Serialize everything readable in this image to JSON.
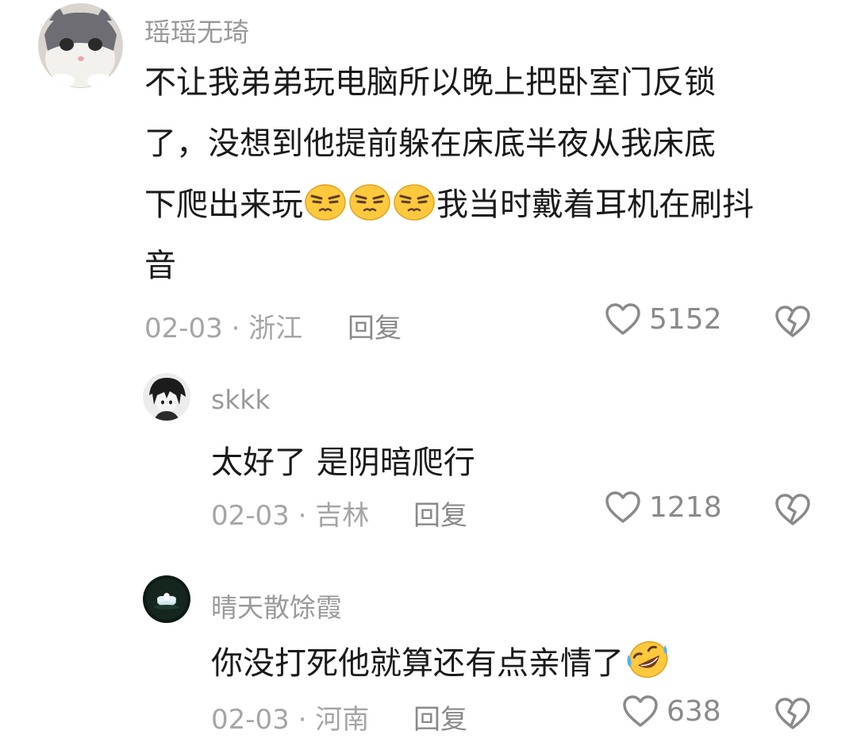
{
  "comments": [
    {
      "username": "瑶瑶无琦",
      "lines": [
        "不让我弟弟玩电脑所以晚上把卧室门反锁",
        "了，没想到他提前躲在床底半夜从我床底",
        "下爬出来玩",
        "我当时戴着耳机在刷抖",
        "音"
      ],
      "date": "02-03",
      "separator": "·",
      "location": "浙江",
      "reply_label": "回复",
      "likes": "5152",
      "inline_emoji": [
        "smirk-emoji-icon",
        "smirk-emoji-icon",
        "smirk-emoji-icon"
      ]
    },
    {
      "username": "skkk",
      "text": "太好了 是阴暗爬行",
      "date": "02-03",
      "separator": "·",
      "location": "吉林",
      "reply_label": "回复",
      "likes": "1218"
    },
    {
      "username": "晴天散馀霞",
      "text": "你没打死他就算还有点亲情了",
      "date": "02-03",
      "separator": "·",
      "location": "河南",
      "reply_label": "回复",
      "likes": "638",
      "trailing_emoji": "rofl-emoji-icon"
    }
  ],
  "icons": {
    "like": "heart-outline-icon",
    "dislike": "broken-heart-icon"
  },
  "colors": {
    "username": "#9a9a9a",
    "meta": "#a5a5a5",
    "body_text": "#1a1a1a",
    "icon_stroke": "#8a8a8a",
    "emoji_face": "#ffc83d"
  }
}
